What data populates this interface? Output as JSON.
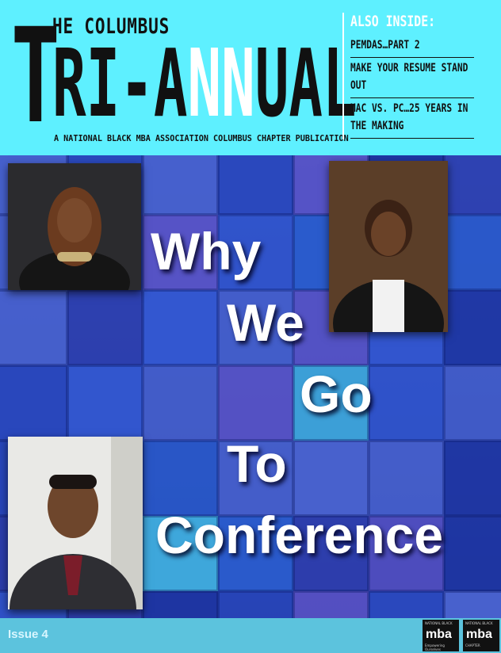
{
  "masthead": {
    "big_letter": "T",
    "the_columbus": "HE COLUMBUS",
    "title_part1": "RI-A",
    "title_part2": "NN",
    "title_part3": "UAL",
    "tagline": "A NATIONAL BLACK MBA ASSOCIATION COLUMBUS CHAPTER PUBLICATION"
  },
  "also_inside": {
    "title": "ALSO INSIDE:",
    "items": [
      "PEMDAS…PART 2",
      "MAKE YOUR RESUME STAND OUT",
      "MAC VS. PC…25 YEARS IN THE MAKING"
    ]
  },
  "headline": {
    "words": [
      "Why",
      "We",
      "Go",
      "To",
      "Conference"
    ]
  },
  "footer": {
    "issue": "Issue 4",
    "logo_left": {
      "top": "NATIONAL BLACK",
      "mark": "mba",
      "sub": "Empowering Ourselves"
    },
    "logo_right": {
      "top": "NATIONAL BLACK",
      "mark": "mba",
      "sub": "CHAPTER"
    }
  },
  "colors": {
    "masthead_bg": "#5ef0ff",
    "footer_bg": "#5cc3dd",
    "mosaic_blue": "#2343b0",
    "headline": "#ffffff"
  }
}
